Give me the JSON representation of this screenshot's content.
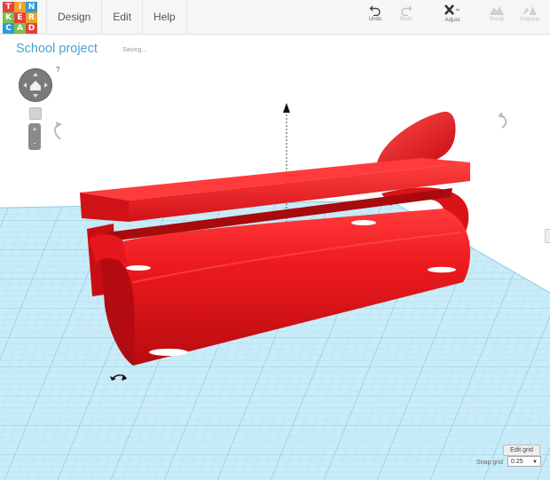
{
  "logo": {
    "letters": [
      "T",
      "I",
      "N",
      "K",
      "E",
      "R",
      "C",
      "A",
      "D"
    ],
    "colors": [
      "#e3403b",
      "#f0a32a",
      "#2e9bd6",
      "#e3403b",
      "#f0a32a",
      "#2e9bd6",
      "#e3403b",
      "#f0a32a",
      "#2e9bd6"
    ]
  },
  "menu": {
    "items": [
      "Design",
      "Edit",
      "Help"
    ]
  },
  "toolbar": {
    "undo": "Undo",
    "redo": "Redo",
    "adjust": "Adjust",
    "group": "Group",
    "ungroup": "Ungroup"
  },
  "project": {
    "title": "School project",
    "status": "Saving..."
  },
  "view": {
    "help": "?",
    "zoom_in": "+",
    "zoom_out": "-"
  },
  "grid": {
    "edit_label": "Edit grid",
    "snap_label": "Snap grid",
    "snap_value": "0.25"
  },
  "colors": {
    "accent": "#4aa3cf",
    "shape": "#e8141c",
    "grid": "#b7e3f4"
  }
}
